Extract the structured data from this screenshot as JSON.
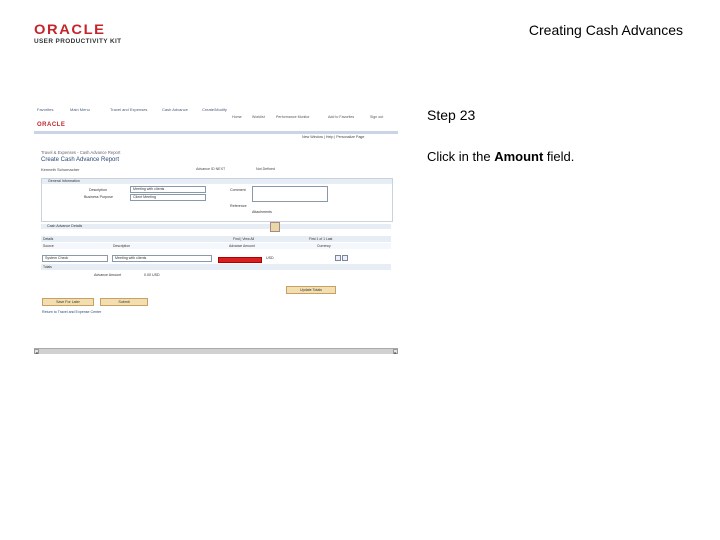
{
  "header": {
    "logo_brand": "ORACLE",
    "logo_product": "USER PRODUCTIVITY KIT",
    "doc_title": "Creating Cash Advances"
  },
  "step": {
    "label": "Step 23",
    "instruction_prefix": "Click in the ",
    "instruction_field": "Amount",
    "instruction_suffix": " field."
  },
  "screenshot": {
    "nav_links": [
      "Favorites",
      "Main Menu",
      "Travel and Expenses",
      "Cash Advance",
      "Create/Modify"
    ],
    "oracle_logo": "ORACLE",
    "menu": [
      "Home",
      "Worklist",
      "Performance Monitor",
      "Add to Favorites",
      "Sign out"
    ],
    "top_links": [
      "New Window",
      "Help",
      "Personalize Page"
    ],
    "breadcrumb": "Travel & Expenses - Cash Advance Report",
    "page_title": "Create Cash Advance Report",
    "employee": "Kenneth Schumacher",
    "advance_id_label": "Advance ID",
    "advance_id": "NEXT",
    "status": "Not Defined",
    "general_info_header": "General Information",
    "description_label": "Description",
    "description_value": "Meeting with clients",
    "business_purpose_label": "Business Purpose",
    "business_purpose_value": "Client Meeting",
    "comment_label": "Comment",
    "reference_label": "Reference",
    "attachments_label": "Attachments",
    "details_section": "Cash Advance Details",
    "details_label": "Details",
    "find_view": "Find | View All",
    "pager": "First 1 of 1 Last",
    "columns": [
      "Source",
      "Description",
      "Advance Amount",
      "Currency"
    ],
    "row": {
      "source": "System Check",
      "description": "Meeting with clients",
      "currency": "USD"
    },
    "totals_label": "Totals",
    "advance_amount_label": "Advance Amount",
    "advance_amount": "0.00 USD",
    "update_totals": "Update Totals",
    "save_for_later": "Save For Later",
    "submit": "Submit",
    "return_link": "Return to Travel and Expense Center"
  },
  "colors": {
    "highlight": "#d92020",
    "brand_red": "#c5242b",
    "button_bg": "#f2deb0"
  }
}
